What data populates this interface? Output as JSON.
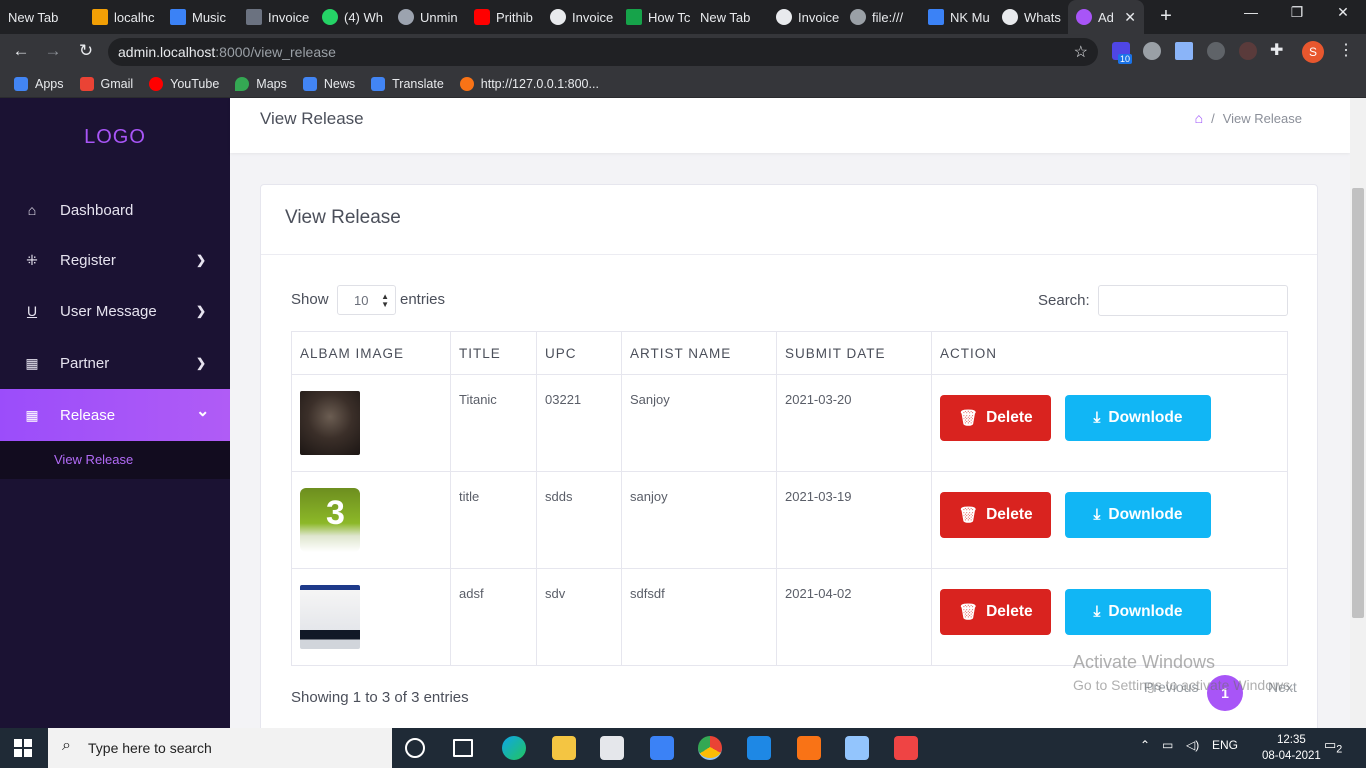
{
  "browser": {
    "tabs": [
      {
        "label": "New Tab",
        "favicon_color": "#202124"
      },
      {
        "label": "localhc",
        "favicon_color": "#f29f05"
      },
      {
        "label": "Music",
        "favicon_color": "#3b82f6"
      },
      {
        "label": "Invoice",
        "favicon_color": "#6b7280"
      },
      {
        "label": "(4) Wh",
        "favicon_color": "#25d366"
      },
      {
        "label": "Unmin",
        "favicon_color": "#9ca3af"
      },
      {
        "label": "Prithib",
        "favicon_color": "#ff0000"
      },
      {
        "label": "Invoice",
        "favicon_color": "#e8eaed"
      },
      {
        "label": "How Tc",
        "favicon_color": "#16a34a"
      },
      {
        "label": "New Tab",
        "favicon_color": "#202124"
      },
      {
        "label": "Invoice",
        "favicon_color": "#e8eaed"
      },
      {
        "label": "file:///",
        "favicon_color": "#9aa0a6"
      },
      {
        "label": "NK Mu",
        "favicon_color": "#3b82f6"
      },
      {
        "label": "Whats",
        "favicon_color": "#e8eaed"
      },
      {
        "label": "Ad",
        "favicon_color": "#a855f7"
      }
    ],
    "new_tab_symbol": "+",
    "window_controls": {
      "minimize": "—",
      "maximize": "❐",
      "close": "✕"
    },
    "url_host": "admin.localhost",
    "url_path": ":8000/view_release",
    "extension_badge": "10",
    "profile_initial": "S",
    "bookmarks": [
      {
        "label": "Apps",
        "color": "#4285f4"
      },
      {
        "label": "Gmail",
        "color": "#ea4335"
      },
      {
        "label": "YouTube",
        "color": "#ff0000"
      },
      {
        "label": "Maps",
        "color": "#34a853"
      },
      {
        "label": "News",
        "color": "#4285f4"
      },
      {
        "label": "Translate",
        "color": "#4285f4"
      },
      {
        "label": "http://127.0.0.1:800...",
        "color": "#f97316"
      }
    ]
  },
  "sidebar": {
    "logo": "LOGO",
    "items": [
      {
        "label": "Dashboard",
        "icon": "⌂",
        "icon_name": "home-icon",
        "chevron": ""
      },
      {
        "label": "Register",
        "icon": "⁜",
        "icon_name": "register-icon",
        "chevron": "❯"
      },
      {
        "label": "User Message",
        "icon": "U",
        "icon_name": "user-message-icon",
        "chevron": "❯"
      },
      {
        "label": "Partner",
        "icon": "▦",
        "icon_name": "grid-icon",
        "chevron": "❯"
      },
      {
        "label": "Release",
        "icon": "▦",
        "icon_name": "grid-icon",
        "chevron": "⌄"
      }
    ],
    "submenu_label": "View Release"
  },
  "header": {
    "title": "View Release",
    "breadcrumb_sep": "/",
    "breadcrumb_current": "View Release"
  },
  "card": {
    "title": "View Release",
    "show_label": "Show",
    "entries_value": "10",
    "entries_label": "entries",
    "search_label": "Search:",
    "search_value": ""
  },
  "table": {
    "columns": [
      "ALBAM IMAGE",
      "TITLE",
      "UPC",
      "ARTIST NAME",
      "SUBMIT DATE",
      "ACTION"
    ],
    "rows": [
      {
        "image": "album-art-dark-ship",
        "title": "Titanic",
        "upc": "03221",
        "artist": "Sanjoy",
        "date": "2021-03-20"
      },
      {
        "image": "w3schools-logo",
        "title": "title",
        "upc": "sdds",
        "artist": "sanjoy",
        "date": "2021-03-19"
      },
      {
        "image": "screenshot-thumbnail",
        "title": "adsf",
        "upc": "sdv",
        "artist": "sdfsdf",
        "date": "2021-04-02"
      }
    ],
    "delete_label": "Delete",
    "download_label": "Downlode"
  },
  "pagination": {
    "info": "Showing 1 to 3 of 3 entries",
    "previous": "Previous",
    "current": "1",
    "next": "Next"
  },
  "watermark": {
    "line1": "Activate Windows",
    "line2": "Go to Settings to activate Windows."
  },
  "taskbar": {
    "search_placeholder": "Type here to search",
    "language": "ENG",
    "time": "12:35",
    "date": "08-04-2021",
    "notifications": "2"
  },
  "colors": {
    "sidebar_bg": "#1b1233",
    "accent": "#a855f7",
    "delete": "#d9231f",
    "download": "#11b6f5"
  }
}
